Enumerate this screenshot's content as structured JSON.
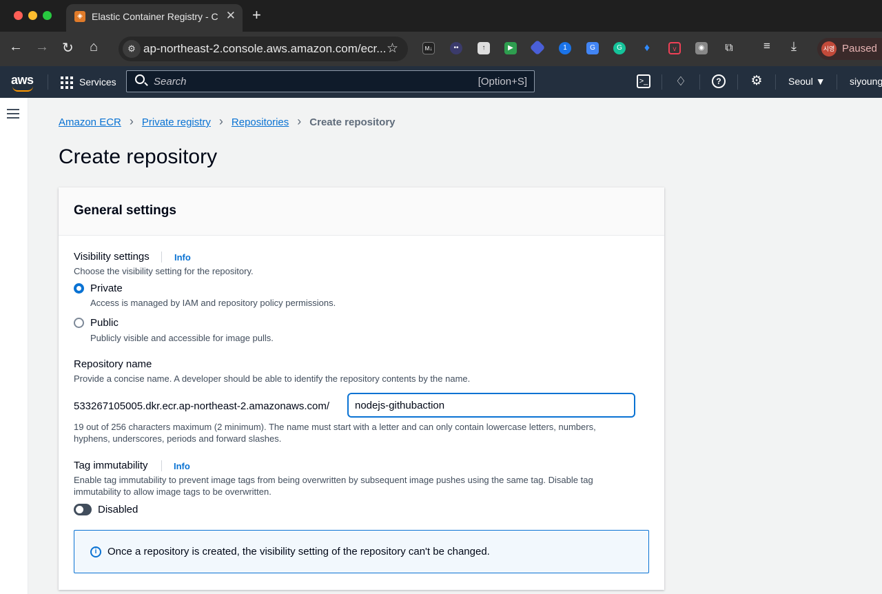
{
  "browser": {
    "tab_title": "Elastic Container Registry - C",
    "tab_favicon": "ecr-icon",
    "url": "ap-northeast-2.console.aws.amazon.com/ecr...",
    "profile_initials": "시영",
    "profile_status": "Paused",
    "extensions": [
      "markdown-icon",
      "ghost-icon",
      "upload-icon",
      "video-icon",
      "diamond-icon",
      "password-icon",
      "translate-icon",
      "grammarly-icon",
      "gem-icon",
      "pocket-icon",
      "camera-icon",
      "puzzle-icon"
    ]
  },
  "aws_header": {
    "logo": "aws",
    "services_label": "Services",
    "search_placeholder": "Search",
    "search_shortcut": "[Option+S]",
    "region": "Seoul ▼",
    "user": "siyoung"
  },
  "breadcrumb": {
    "items": [
      "Amazon ECR",
      "Private registry",
      "Repositories"
    ],
    "current": "Create repository"
  },
  "page_title": "Create repository",
  "general_settings": {
    "title": "General settings",
    "visibility": {
      "label": "Visibility settings",
      "info": "Info",
      "description": "Choose the visibility setting for the repository.",
      "options": [
        {
          "label": "Private",
          "description": "Access is managed by IAM and repository policy permissions.",
          "selected": true
        },
        {
          "label": "Public",
          "description": "Publicly visible and accessible for image pulls.",
          "selected": false
        }
      ]
    },
    "repository_name": {
      "label": "Repository name",
      "description": "Provide a concise name. A developer should be able to identify the repository contents by the name.",
      "prefix": "533267105005.dkr.ecr.ap-northeast-2.amazonaws.com/",
      "value": "nodejs-githubaction",
      "hint_line1": "19 out of 256 characters maximum (2 minimum). The name must start with a letter and can only contain lowercase letters, numbers,",
      "hint_line2": "hyphens, underscores, periods and forward slashes."
    },
    "tag_immutability": {
      "label": "Tag immutability",
      "info": "Info",
      "description_line1": "Enable tag immutability to prevent image tags from being overwritten by subsequent image pushes using the same tag. Disable tag",
      "description_line2": "immutability to allow image tags to be overwritten.",
      "toggle_label": "Disabled",
      "enabled": false
    },
    "alert": "Once a repository is created, the visibility setting of the repository can't be changed."
  },
  "colors": {
    "accent": "#0972d3",
    "aws_nav": "#232f3e",
    "aws_orange": "#ff9900"
  }
}
